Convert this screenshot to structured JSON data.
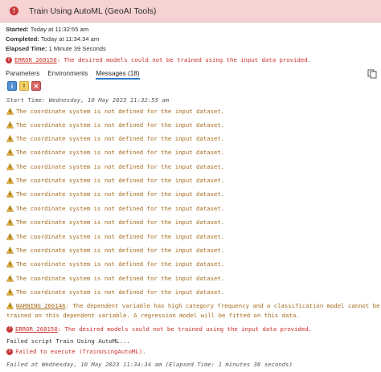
{
  "title": "Train Using AutoML (GeoAI Tools)",
  "meta": {
    "started_label": "Started:",
    "started_value": "Today at 11:32:55 am",
    "completed_label": "Completed:",
    "completed_value": "Today at 11:34:34 am",
    "elapsed_label": "Elapsed Time:",
    "elapsed_value": "1 Minute 39 Seconds"
  },
  "summary_error": {
    "code": "ERROR 260150",
    "text": ": The desired models could not be trained using the input data provided."
  },
  "tabs": [
    {
      "label": "Parameters",
      "active": false
    },
    {
      "label": "Environments",
      "active": false
    },
    {
      "label": "Messages (18)",
      "active": true
    }
  ],
  "messages": {
    "start": "Start Time: Wednesday, 10 May 2023 11:32:55 am",
    "coord_warning": "The coordinate system is not defined for the input dataset.",
    "warning_260146_code": "WARNING 260146",
    "warning_260146_line1": ": The dependent variable has high category frequency and a classification model cannot be",
    "warning_260146_line2": "trained on this dependent variable. A regression model will be fitted on this data.",
    "error_260150_code": "ERROR 260150",
    "error_260150_text": ": The desired models could not be trained using the input data provided.",
    "failed_script": "Failed script Train Using AutoML...",
    "failed_execute": "Failed to execute (TrainUsingAutoML).",
    "end": "Failed at Wednesday, 10 May 2023 11:34:34 am (Elapsed Time: 1 minutes 38 seconds)"
  },
  "colors": {
    "title_bg": "#f7d2d2",
    "error": "#c8302a",
    "warning": "#a56a1a",
    "tab_accent": "#2a7ac9"
  }
}
